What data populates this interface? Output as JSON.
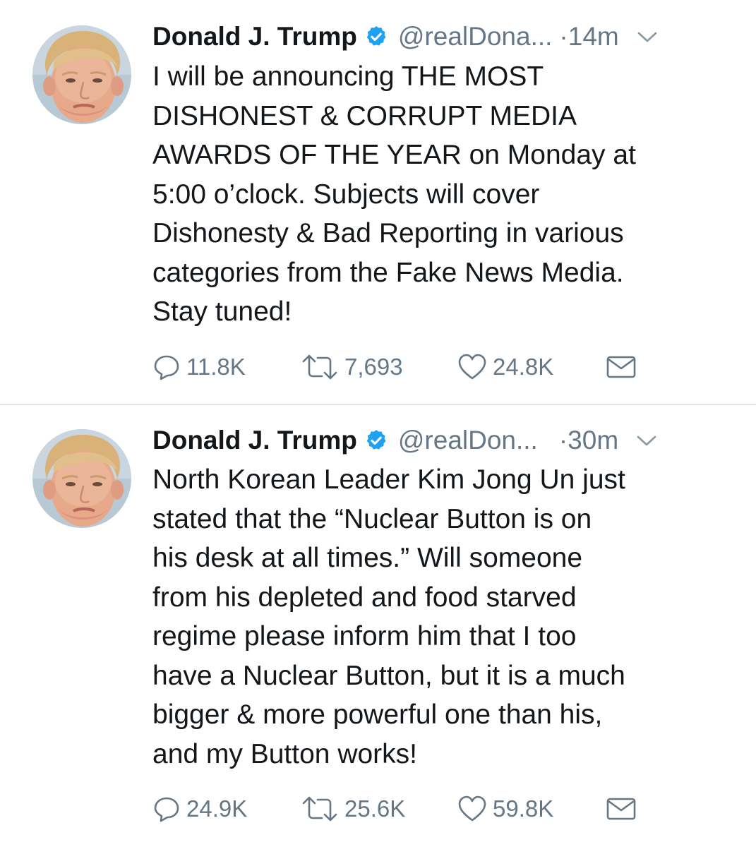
{
  "colors": {
    "text": "#14171a",
    "secondary": "#657786",
    "verified": "#1da1f2",
    "divider": "#e1e8ed"
  },
  "tweets": [
    {
      "author_name": "Donald J. Trump",
      "verified_icon": "verified-badge-icon",
      "handle": "@realDona...",
      "time": "·14m",
      "text": "I will be announcing THE MOST\nDISHONEST & CORRUPT MEDIA\nAWARDS OF THE YEAR on Monday at\n5:00 o’clock. Subjects will cover\nDishonesty & Bad Reporting in various\ncategories from the Fake News Media.\nStay tuned!",
      "replies": "11.8K",
      "retweets": "7,693",
      "likes": "24.8K"
    },
    {
      "author_name": "Donald J. Trump",
      "verified_icon": "verified-badge-icon",
      "handle": "@realDon...",
      "time": "·30m",
      "text": "North Korean Leader Kim Jong Un just\nstated that the “Nuclear Button is on\nhis desk at all times.” Will someone\nfrom his depleted and food starved\nregime please inform him that I too\nhave a Nuclear Button, but it is a much\nbigger & more powerful one than his,\nand my Button works!",
      "replies": "24.9K",
      "retweets": "25.6K",
      "likes": "59.8K"
    }
  ]
}
